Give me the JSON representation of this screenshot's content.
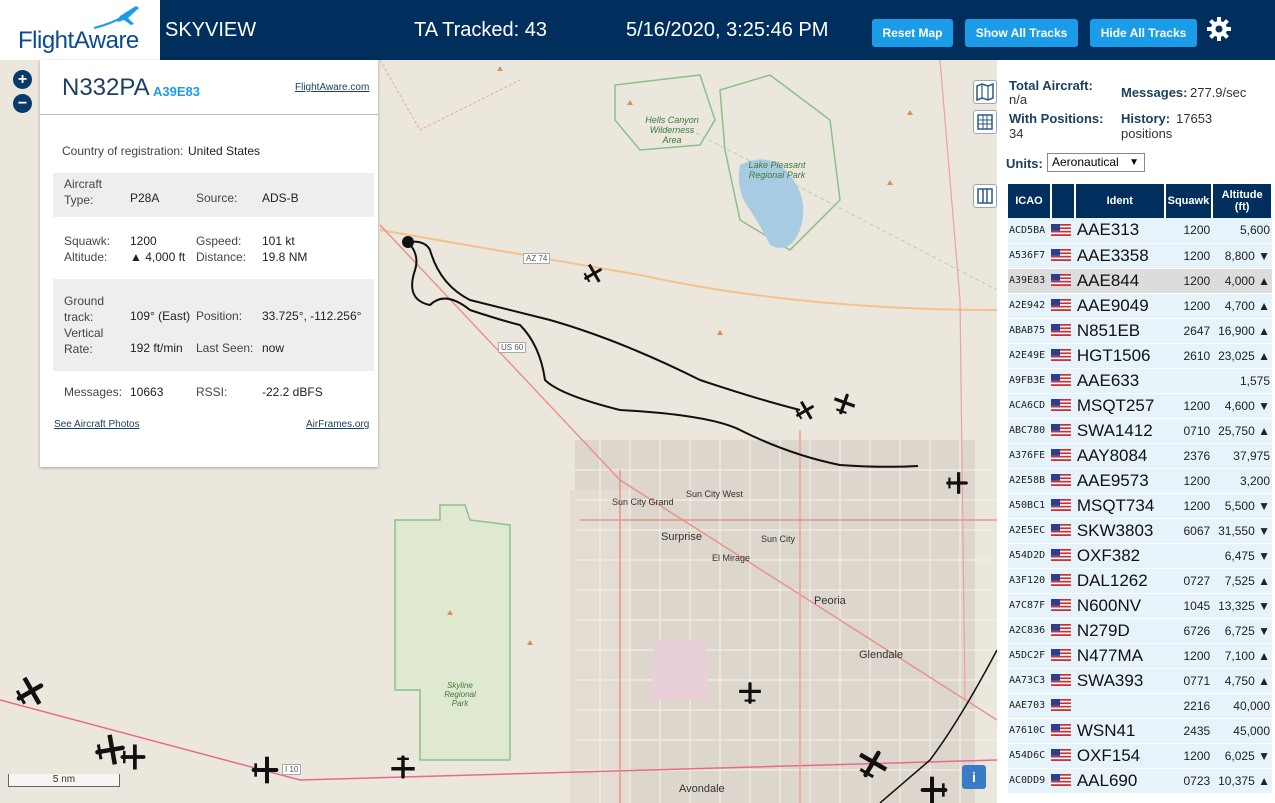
{
  "header": {
    "logo": "FlightAware",
    "app_name": "SKYVIEW",
    "ta_tracked": "TA Tracked: 43",
    "datetime": "5/16/2020, 3:25:46 PM",
    "buttons": {
      "reset_map": "Reset Map",
      "show_all": "Show All Tracks",
      "hide_all": "Hide All Tracks"
    }
  },
  "map": {
    "zoom_in": "+",
    "zoom_out": "−",
    "scale_label": "5 nm",
    "info_button": "i",
    "places": {
      "hells_canyon": "Hells Canyon Wilderness Area",
      "lake_pleasant": "Lake Pleasant Regional Park",
      "sun_city_grand": "Sun City Grand",
      "sun_city_west": "Sun City West",
      "surprise": "Surprise",
      "el_mirage": "El Mirage",
      "sun_city": "Sun City",
      "peoria": "Peoria",
      "glendale": "Glendale",
      "skyline": "Skyline Regional Park",
      "avondale": "Avondale",
      "az74": "AZ 74",
      "us60": "US 60",
      "i10": "I 10"
    }
  },
  "panel": {
    "registration": "N332PA",
    "icao": "A39E83",
    "fa_link": "FlightAware.com",
    "country_label": "Country of registration:",
    "country": "United States",
    "type_label": "Aircraft Type:",
    "type": "P28A",
    "source_label": "Source:",
    "source": "ADS-B",
    "squawk_label": "Squawk:",
    "squawk": "1200",
    "gspeed_label": "Gspeed:",
    "gspeed": "101 kt",
    "altitude_label": "Altitude:",
    "altitude": "▲ 4,000 ft",
    "distance_label": "Distance:",
    "distance": "19.8 NM",
    "track_label": "Ground track:",
    "track": "109° (East)",
    "position_label": "Position:",
    "position": "33.725°, -112.256°",
    "vrate_label": "Vertical Rate:",
    "vrate": "192 ft/min",
    "lastseen_label": "Last Seen:",
    "lastseen": "now",
    "messages_label": "Messages:",
    "messages": "10663",
    "rssi_label": "RSSI:",
    "rssi": "-22.2 dBFS",
    "photos_link": "See Aircraft Photos",
    "airframes_link": "AirFrames.org"
  },
  "sidebar": {
    "total_aircraft_label": "Total Aircraft:",
    "total_aircraft": "n/a",
    "messages_label": "Messages:",
    "messages": "277.9/sec",
    "with_positions_label": "With Positions:",
    "with_positions": "34",
    "history_label": "History:",
    "history": "17653 positions",
    "units_label": "Units:",
    "units_value": "Aeronautical",
    "columns": [
      "ICAO",
      "",
      "Ident",
      "Squawk",
      "Altitude (ft)"
    ],
    "rows": [
      {
        "icao": "ACD5BA",
        "ident": "AAE313",
        "squawk": "1200",
        "alt": "5,600"
      },
      {
        "icao": "A536F7",
        "ident": "AAE3358",
        "squawk": "1200",
        "alt": "8,800 ▼"
      },
      {
        "icao": "A39E83",
        "ident": "AAE844",
        "squawk": "1200",
        "alt": "4,000 ▲"
      },
      {
        "icao": "A2E942",
        "ident": "AAE9049",
        "squawk": "1200",
        "alt": "4,700 ▲"
      },
      {
        "icao": "ABAB75",
        "ident": "N851EB",
        "squawk": "2647",
        "alt": "16,900 ▲"
      },
      {
        "icao": "A2E49E",
        "ident": "HGT1506",
        "squawk": "2610",
        "alt": "23,025 ▲"
      },
      {
        "icao": "A9FB3E",
        "ident": "AAE633",
        "squawk": "",
        "alt": "1,575"
      },
      {
        "icao": "ACA6CD",
        "ident": "MSQT257",
        "squawk": "1200",
        "alt": "4,600 ▼"
      },
      {
        "icao": "ABC780",
        "ident": "SWA1412",
        "squawk": "0710",
        "alt": "25,750 ▲"
      },
      {
        "icao": "A376FE",
        "ident": "AAY8084",
        "squawk": "2376",
        "alt": "37,975"
      },
      {
        "icao": "A2E58B",
        "ident": "AAE9573",
        "squawk": "1200",
        "alt": "3,200"
      },
      {
        "icao": "A50BC1",
        "ident": "MSQT734",
        "squawk": "1200",
        "alt": "5,500 ▼"
      },
      {
        "icao": "A2E5EC",
        "ident": "SKW3803",
        "squawk": "6067",
        "alt": "31,550 ▼"
      },
      {
        "icao": "A54D2D",
        "ident": "OXF382",
        "squawk": "",
        "alt": "6,475 ▼"
      },
      {
        "icao": "A3F120",
        "ident": "DAL1262",
        "squawk": "0727",
        "alt": "7,525 ▲"
      },
      {
        "icao": "A7C87F",
        "ident": "N600NV",
        "squawk": "1045",
        "alt": "13,325 ▼"
      },
      {
        "icao": "A2C836",
        "ident": "N279D",
        "squawk": "6726",
        "alt": "6,725 ▼"
      },
      {
        "icao": "A5DC2F",
        "ident": "N477MA",
        "squawk": "1200",
        "alt": "7,100 ▲"
      },
      {
        "icao": "AA73C3",
        "ident": "SWA393",
        "squawk": "0771",
        "alt": "4,750 ▲"
      },
      {
        "icao": "AAE703",
        "ident": "",
        "squawk": "2216",
        "alt": "40,000"
      },
      {
        "icao": "A7610C",
        "ident": "WSN41",
        "squawk": "2435",
        "alt": "45,000"
      },
      {
        "icao": "A54D6C",
        "ident": "OXF154",
        "squawk": "1200",
        "alt": "6,025 ▼"
      },
      {
        "icao": "AC0DD9",
        "ident": "AAL690",
        "squawk": "0723",
        "alt": "10,375 ▲"
      }
    ]
  },
  "colors": {
    "header": "#002f5d",
    "button": "#1a9ce8",
    "row": "#e6f3fb",
    "selected_row": "#dcdcdc"
  }
}
